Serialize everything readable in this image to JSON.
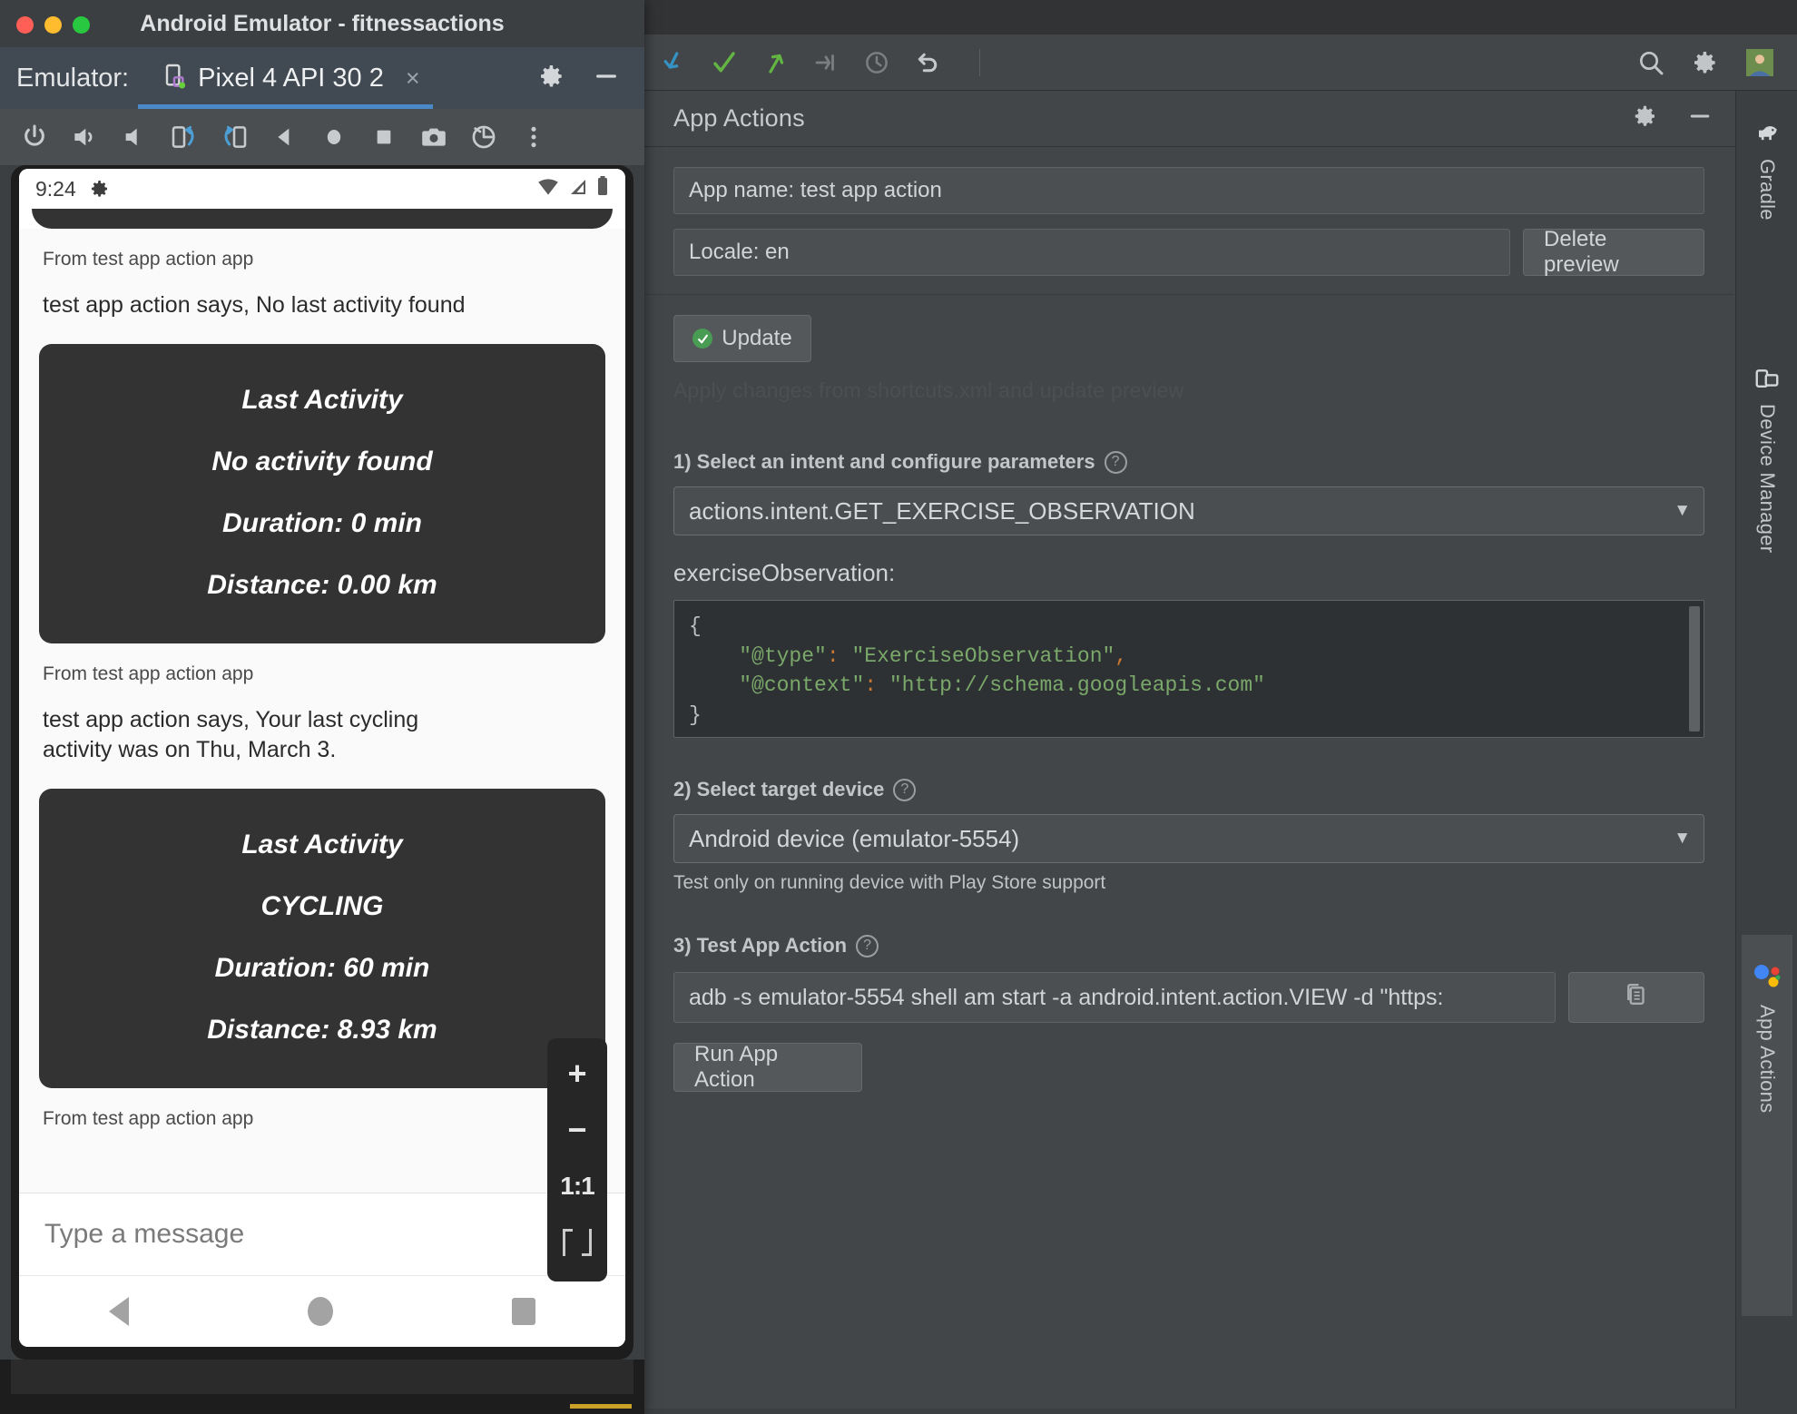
{
  "emulator": {
    "window_title": "Android Emulator - fitnessactions",
    "emulator_label": "Emulator:",
    "tab_name": "Pixel 4 API 30 2",
    "tab_close": "×",
    "toolbar_icons": [
      "power-icon",
      "volume-up-icon",
      "volume-down-icon",
      "rotate-left-icon",
      "rotate-right-icon",
      "back-icon",
      "home-icon",
      "overview-icon",
      "screenshot-icon",
      "restore-icon",
      "more-icon"
    ],
    "header_icons": [
      "gear-icon",
      "minimize-icon"
    ],
    "phone": {
      "status_time": "9:24",
      "status_icons": [
        "gear-icon",
        "wifi-icon",
        "signal-icon",
        "battery-icon"
      ],
      "messages": [
        {
          "source": "From test app action app",
          "says": "test app action says, No last activity found",
          "card": {
            "title": "Last Activity",
            "activity": "No activity found",
            "duration": "Duration: 0 min",
            "distance": "Distance: 0.00 km"
          }
        },
        {
          "source": "From test app action app",
          "says": "test app action says, Your last cycling activity was on Thu, March 3.",
          "card": {
            "title": "Last Activity",
            "activity": "CYCLING",
            "duration": "Duration: 60 min",
            "distance": "Distance: 8.93 km"
          }
        },
        {
          "source": "From test app action app",
          "says": "",
          "card": null
        }
      ],
      "message_placeholder": "Type a message",
      "nav_icons": [
        "back-icon",
        "home-icon",
        "recents-icon"
      ]
    },
    "zoom_controls": {
      "zoom_in": "+",
      "zoom_out": "−",
      "actual_size": "1:1",
      "fit_to_window": "fit-screen-icon"
    }
  },
  "ide": {
    "toolbar_icons": [
      "pull-down-icon",
      "accept-icon",
      "push-up-icon",
      "diff-icon",
      "history-icon",
      "revert-icon"
    ],
    "toolbar_right_icons": [
      "search-icon",
      "gear-icon",
      "avatar-icon"
    ],
    "right_tool_tabs": [
      {
        "label": "Gradle",
        "icon": "gradle-elephant-icon",
        "active": false
      },
      {
        "label": "Device Manager",
        "icon": "device-manager-icon",
        "active": false
      },
      {
        "label": "App Actions",
        "icon": "google-assistant-icon",
        "active": true
      }
    ]
  },
  "app_actions": {
    "title": "App Actions",
    "header_icons": [
      "gear-icon",
      "minimize-icon"
    ],
    "app_name_field": "App name: test app action",
    "locale_field": "Locale: en",
    "delete_preview_label": "Delete preview",
    "update_label": "Update",
    "update_hint": "Apply changes from shortcuts.xml and update preview",
    "step1_label": "1) Select an intent and configure parameters",
    "intent_value": "actions.intent.GET_EXERCISE_OBSERVATION",
    "param_label": "exerciseObservation:",
    "param_json": {
      "line1": "{",
      "line2_key": "\"@type\"",
      "line2_colon": ":",
      "line2_val": "\"ExerciseObservation\"",
      "line2_comma": ",",
      "line3_key": "\"@context\"",
      "line3_colon": ":",
      "line3_val": "\"http://schema.googleapis.com\"",
      "line4": "}"
    },
    "step2_label": "2) Select target device",
    "device_value": "Android device (emulator-5554)",
    "device_note": "Test only on running device with Play Store support",
    "step3_label": "3) Test App Action",
    "adb_command": "adb -s emulator-5554 shell am start -a android.intent.action.VIEW -d \"https:",
    "copy_icon": "copy-icon",
    "run_label": "Run App Action",
    "help_icon": "help-icon",
    "dropdown_caret": "▼"
  },
  "colors": {
    "panel_bg": "#434649",
    "field_bg": "#4b4f51",
    "code_bg": "#2e3133",
    "accent_blue": "#4a88c7",
    "green_check": "#499c54",
    "json_string": "#7aa86a",
    "json_punct": "#cc7832"
  }
}
